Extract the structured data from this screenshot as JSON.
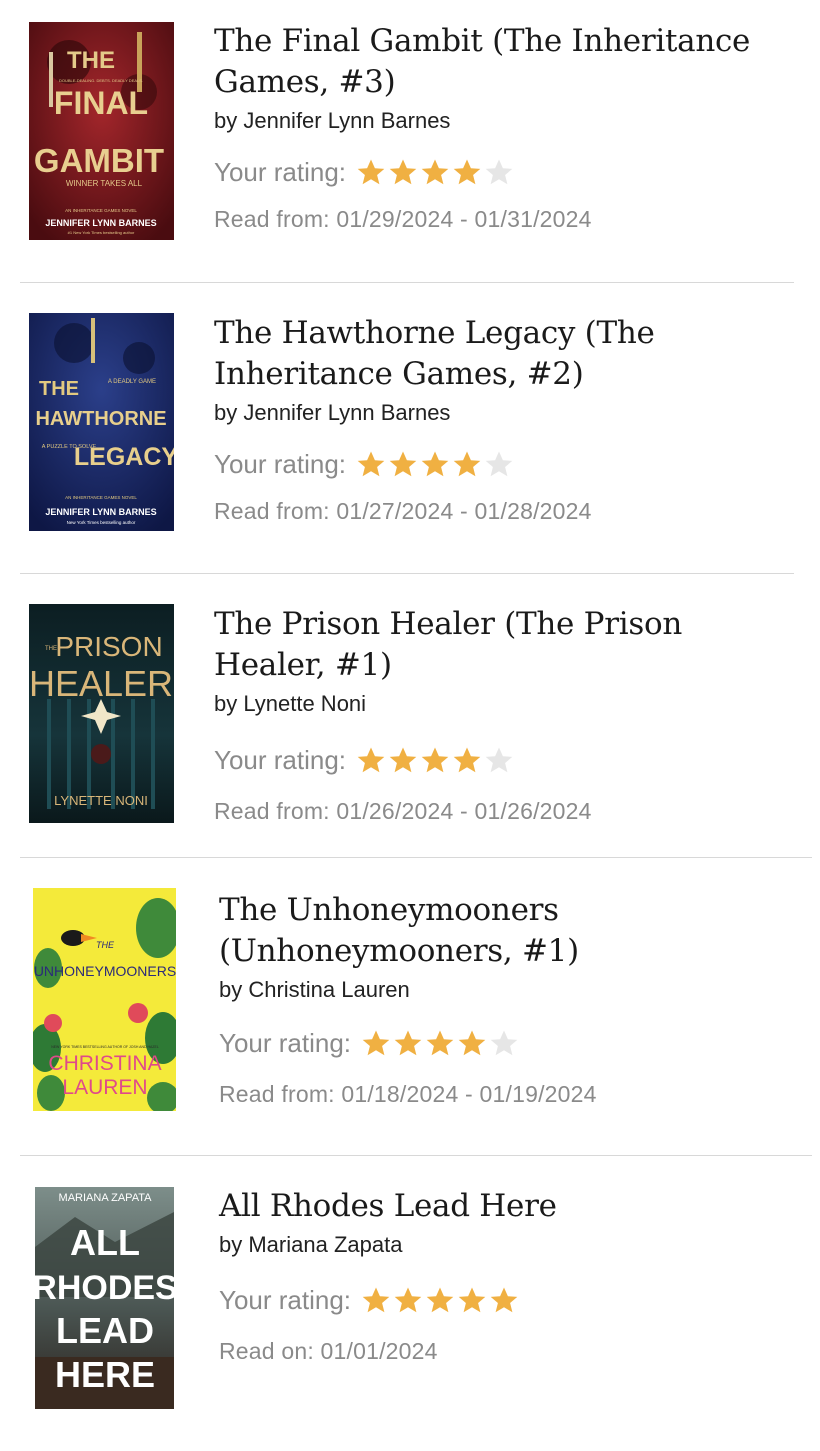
{
  "books": [
    {
      "title": "The Final Gambit (The Inheritance Games, #3)",
      "author": "by Jennifer Lynn Barnes",
      "rating_label": "Your rating:",
      "rating": 4,
      "max_rating": 5,
      "dates": "Read from: 01/29/2024 - 01/31/2024",
      "cover": {
        "line1": "THE",
        "line2": "FINAL",
        "line3": "GAMBIT",
        "tagline_top": "DOUBLE-DEALING. DEBTS. DEADLY DEALS.",
        "tagline_bottom": "WINNER TAKES ALL",
        "series": "AN INHERITANCE GAMES NOVEL",
        "author": "JENNIFER LYNN BARNES",
        "blurb": "#1 New York Times bestselling author"
      }
    },
    {
      "title": "The Hawthorne Legacy (The Inheritance Games, #2)",
      "author": "by Jennifer Lynn Barnes",
      "rating_label": "Your rating:",
      "rating": 4,
      "max_rating": 5,
      "dates": "Read from: 01/27/2024 - 01/28/2024",
      "cover": {
        "line1": "THE",
        "line2": "HAWTHORNE",
        "line3": "LEGACY",
        "tagline_top": "A DEADLY GAME",
        "tagline_bottom": "A PUZZLE TO SOLVE",
        "series": "AN INHERITANCE GAMES NOVEL",
        "author": "JENNIFER LYNN BARNES",
        "blurb": "New York Times bestselling author"
      }
    },
    {
      "title": "The Prison Healer (The Prison Healer, #1)",
      "author": "by Lynette Noni",
      "rating_label": "Your rating:",
      "rating": 4,
      "max_rating": 5,
      "dates": "Read from: 01/26/2024 - 01/26/2024",
      "cover": {
        "line1": "THE",
        "line2": "PRISON",
        "line3": "HEALER",
        "author": "LYNETTE NONI"
      }
    },
    {
      "title": "The Unhoneymooners (Unhoneymooners, #1)",
      "author": "by Christina Lauren",
      "rating_label": "Your rating:",
      "rating": 4,
      "max_rating": 5,
      "dates": "Read from: 01/18/2024 - 01/19/2024",
      "cover": {
        "line1": "THE",
        "line2": "UNHONEYMOONERS",
        "blurb": "NEW YORK TIMES BESTSELLING AUTHOR OF JOSH AND HAZEL",
        "author1": "CHRISTINA",
        "author2": "LAUREN"
      }
    },
    {
      "title": "All Rhodes Lead Here",
      "author": "by Mariana Zapata",
      "rating_label": "Your rating:",
      "rating": 5,
      "max_rating": 5,
      "dates": "Read on: 01/01/2024",
      "cover": {
        "author": "MARIANA ZAPATA",
        "line1": "ALL",
        "line2": "RHODES",
        "line3": "LEAD",
        "line4": "HERE"
      }
    }
  ],
  "colors": {
    "star_filled": "#F0B042",
    "star_empty": "#E6E6E6",
    "title": "#1a1a1a",
    "muted": "#8a8a8a",
    "divider": "#d8d8d8"
  }
}
